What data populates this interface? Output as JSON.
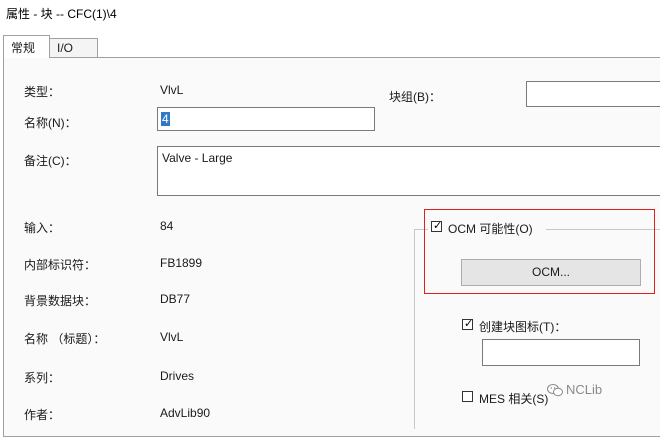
{
  "window": {
    "title": "属性 - 块 -- CFC(1)\\4"
  },
  "tabs": [
    {
      "label": "常规"
    },
    {
      "label": "I/O"
    }
  ],
  "general": {
    "type_label": "类型：",
    "type_value": "VlvL",
    "name_label": "名称(N)：",
    "name_value": "4",
    "blockgroup_label": "块组(B)：",
    "blockgroup_value": "",
    "comment_label": "备注(C)：",
    "comment_value": "Valve - Large",
    "input_label": "输入：",
    "input_value": "84",
    "internal_id_label": "内部标识符：",
    "internal_id_value": "FB1899",
    "background_db_label": "背景数据块：",
    "background_db_value": "DB77",
    "name_title_label": "名称 （标题）：",
    "name_title_value": "VlvL",
    "family_label": "系列：",
    "family_value": "Drives",
    "author_label": "作者：",
    "author_value": "AdvLib90"
  },
  "ocm": {
    "checkbox_label": "OCM 可能性(O)",
    "checked": true,
    "button_label": "OCM..."
  },
  "create_icon": {
    "checkbox_label": "创建块图标(T)：",
    "checked": true,
    "value": ""
  },
  "mes": {
    "checkbox_label": "MES 相关(S)",
    "checked": false
  },
  "watermark": {
    "text": "NCLib",
    "icon": "wechat-icon"
  },
  "colors": {
    "highlight": "#e02020",
    "selection": "#3178c6"
  }
}
